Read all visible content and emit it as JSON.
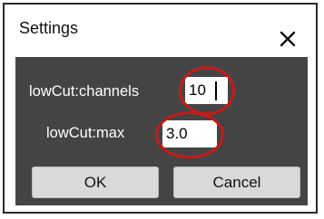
{
  "dialog": {
    "title": "Settings",
    "close_icon": "close-icon"
  },
  "fields": {
    "channels_label": "lowCut:channels",
    "channels_value": "10",
    "max_label": "lowCut:max",
    "max_value": "3.0"
  },
  "buttons": {
    "ok_label": "OK",
    "cancel_label": "Cancel"
  },
  "colors": {
    "client_background": "#444444",
    "highlight": "#c61a1a",
    "button_background": "#d9d9d9"
  }
}
